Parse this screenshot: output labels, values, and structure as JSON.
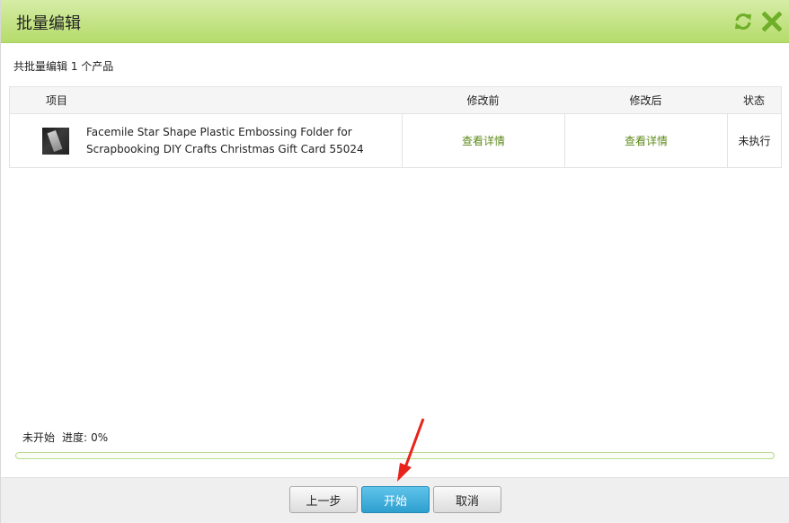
{
  "dialog": {
    "title": "批量编辑",
    "summary": "共批量编辑 1 个产品"
  },
  "table": {
    "headers": {
      "item": "项目",
      "before": "修改前",
      "after": "修改后",
      "status": "状态"
    },
    "rows": [
      {
        "name": "Facemile Star Shape Plastic Embossing Folder for Scrapbooking DIY Crafts Christmas Gift Card 55024",
        "before_link": "查看详情",
        "after_link": "查看详情",
        "status": "未执行"
      }
    ]
  },
  "progress": {
    "state": "未开始",
    "label": "进度:",
    "value": "0%",
    "fraction": 0
  },
  "footer": {
    "prev_label": "上一步",
    "start_label": "开始",
    "cancel_label": "取消"
  },
  "colors": {
    "header_bg": "#b5dc6b",
    "link": "#5d8a1a",
    "primary_button": "#2e9fcf",
    "annotation_arrow": "#e8231c"
  },
  "icons": {
    "refresh": "refresh-icon",
    "close": "close-icon",
    "annotation": "red-arrow-annotation"
  }
}
